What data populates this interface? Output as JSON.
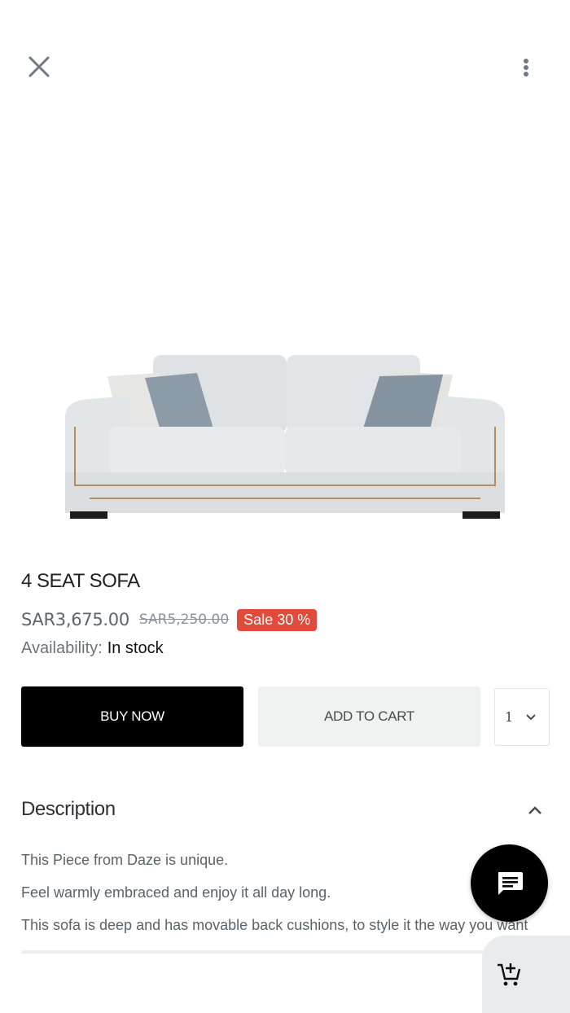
{
  "top_bar": {
    "close_icon": "close-icon",
    "more_icon": "more-vertical-icon"
  },
  "product": {
    "title": "4 SEAT SOFA",
    "price": "SAR3,675.00",
    "old_price": "SAR5,250.00",
    "sale_badge": "Sale 30 %",
    "availability_label": "Availability:",
    "availability_value": "In stock",
    "image_icon": "sofa-image"
  },
  "actions": {
    "buy_now": "BUY NOW",
    "add_to_cart": "ADD TO CART",
    "quantity": "1"
  },
  "description": {
    "heading": "Description",
    "lines": [
      "This Piece from Daze is unique.",
      "Feel warmly embraced and enjoy it all day long.",
      "This sofa is deep and has movable back cushions, to style it the way you want"
    ]
  },
  "colors": {
    "sale": "#e24b3b",
    "primary_button": "#000000",
    "secondary_button": "#f0f1f1"
  }
}
